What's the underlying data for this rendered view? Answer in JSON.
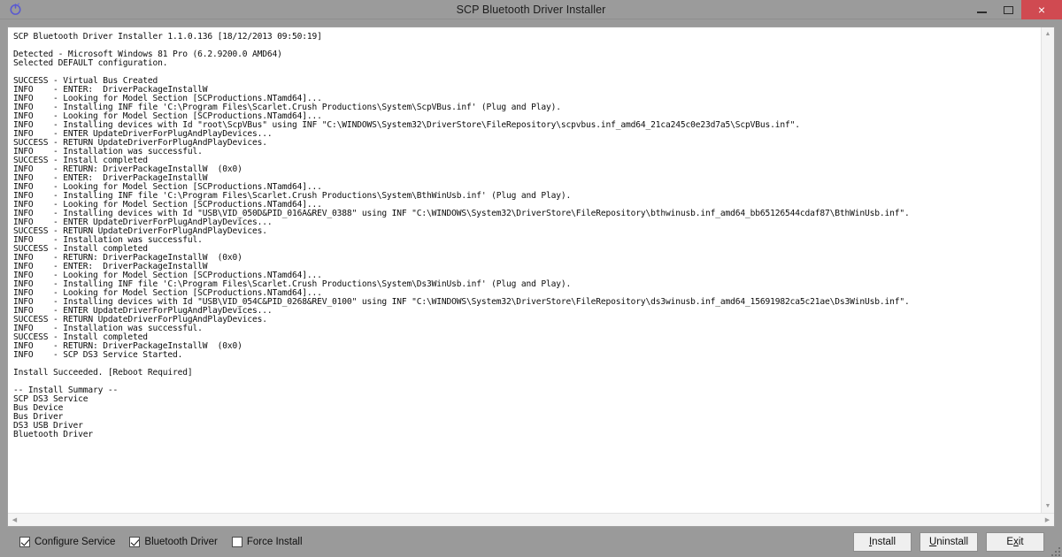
{
  "window": {
    "title": "SCP Bluetooth Driver Installer",
    "app_icon": "scp-circle-icon",
    "controls": {
      "minimize": "minimize-icon",
      "maximize": "maximize-icon",
      "close": "close-icon",
      "close_glyph": "×"
    },
    "accent_close_color": "#d04a51",
    "titlebar_color": "#9b9b9b",
    "body_color": "#9a9a9a"
  },
  "log": {
    "lines": [
      "SCP Bluetooth Driver Installer 1.1.0.136 [18/12/2013 09:50:19]",
      "",
      "Detected - Microsoft Windows 81 Pro (6.2.9200.0 AMD64)",
      "Selected DEFAULT configuration.",
      "",
      "SUCCESS - Virtual Bus Created",
      "INFO    - ENTER:  DriverPackageInstallW",
      "INFO    - Looking for Model Section [SCProductions.NTamd64]...",
      "INFO    - Installing INF file 'C:\\Program Files\\Scarlet.Crush Productions\\System\\ScpVBus.inf' (Plug and Play).",
      "INFO    - Looking for Model Section [SCProductions.NTamd64]...",
      "INFO    - Installing devices with Id \"root\\ScpVBus\" using INF \"C:\\WINDOWS\\System32\\DriverStore\\FileRepository\\scpvbus.inf_amd64_21ca245c0e23d7a5\\ScpVBus.inf\".",
      "INFO    - ENTER UpdateDriverForPlugAndPlayDevices...",
      "SUCCESS - RETURN UpdateDriverForPlugAndPlayDevices.",
      "INFO    - Installation was successful.",
      "SUCCESS - Install completed",
      "INFO    - RETURN: DriverPackageInstallW  (0x0)",
      "INFO    - ENTER:  DriverPackageInstallW",
      "INFO    - Looking for Model Section [SCProductions.NTamd64]...",
      "INFO    - Installing INF file 'C:\\Program Files\\Scarlet.Crush Productions\\System\\BthWinUsb.inf' (Plug and Play).",
      "INFO    - Looking for Model Section [SCProductions.NTamd64]...",
      "INFO    - Installing devices with Id \"USB\\VID_050D&PID_016A&REV_0388\" using INF \"C:\\WINDOWS\\System32\\DriverStore\\FileRepository\\bthwinusb.inf_amd64_bb65126544cdaf87\\BthWinUsb.inf\".",
      "INFO    - ENTER UpdateDriverForPlugAndPlayDevices...",
      "SUCCESS - RETURN UpdateDriverForPlugAndPlayDevices.",
      "INFO    - Installation was successful.",
      "SUCCESS - Install completed",
      "INFO    - RETURN: DriverPackageInstallW  (0x0)",
      "INFO    - ENTER:  DriverPackageInstallW",
      "INFO    - Looking for Model Section [SCProductions.NTamd64]...",
      "INFO    - Installing INF file 'C:\\Program Files\\Scarlet.Crush Productions\\System\\Ds3WinUsb.inf' (Plug and Play).",
      "INFO    - Looking for Model Section [SCProductions.NTamd64]...",
      "INFO    - Installing devices with Id \"USB\\VID_054C&PID_0268&REV_0100\" using INF \"C:\\WINDOWS\\System32\\DriverStore\\FileRepository\\ds3winusb.inf_amd64_15691982ca5c21ae\\Ds3WinUsb.inf\".",
      "INFO    - ENTER UpdateDriverForPlugAndPlayDevices...",
      "SUCCESS - RETURN UpdateDriverForPlugAndPlayDevices.",
      "INFO    - Installation was successful.",
      "SUCCESS - Install completed",
      "INFO    - RETURN: DriverPackageInstallW  (0x0)",
      "INFO    - SCP DS3 Service Started.",
      "",
      "Install Succeeded. [Reboot Required]",
      "",
      "-- Install Summary --",
      "SCP DS3 Service",
      "Bus Device",
      "Bus Driver",
      "DS3 USB Driver",
      "Bluetooth Driver"
    ]
  },
  "scrollbars": {
    "vertical": {
      "up_glyph": "▲",
      "down_glyph": "▼"
    },
    "horizontal": {
      "left_glyph": "◀",
      "right_glyph": "▶"
    }
  },
  "options": [
    {
      "label": "Configure Service",
      "checked": true,
      "name": "configure-service"
    },
    {
      "label": "Bluetooth Driver",
      "checked": true,
      "name": "bluetooth-driver"
    },
    {
      "label": "Force Install",
      "checked": false,
      "name": "force-install"
    }
  ],
  "buttons": [
    {
      "name": "install-button",
      "pre": "",
      "mnemonic": "I",
      "post": "nstall"
    },
    {
      "name": "uninstall-button",
      "pre": "",
      "mnemonic": "U",
      "post": "ninstall"
    },
    {
      "name": "exit-button",
      "pre": "E",
      "mnemonic": "x",
      "post": "it"
    }
  ]
}
